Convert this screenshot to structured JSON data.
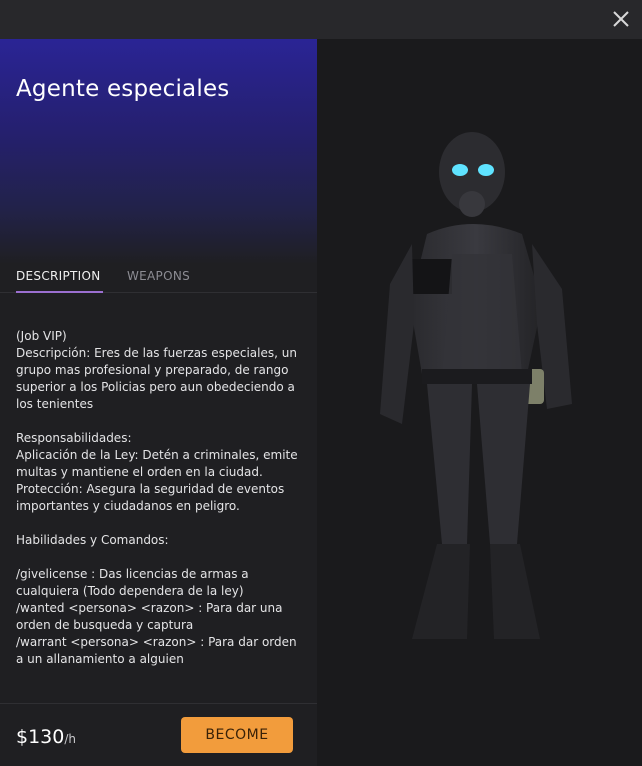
{
  "window": {
    "close_icon": "close-icon"
  },
  "job": {
    "title": "Agente especiales",
    "header_colors": {
      "top": "#2a2495",
      "bottom": "#1f1f22"
    }
  },
  "tabs": [
    {
      "label": "DESCRIPTION",
      "active": true
    },
    {
      "label": "WEAPONS",
      "active": false
    }
  ],
  "description": "(Job VIP)\nDescripción: Eres de las fuerzas especiales, un grupo mas profesional y preparado, de rango superior a los Policias pero aun obedeciendo a los tenientes\n\nResponsabilidades:\nAplicación de la Ley: Detén a criminales, emite multas y mantiene el orden en la ciudad.\nProtección: Asegura la seguridad de eventos importantes y ciudadanos en peligro.\n\nHabilidades y Comandos:\n\n/givelicense : Das licencias de armas a cualquiera (Todo dependera de la ley)\n/wanted <persona> <razon> : Para dar una orden de busqueda y captura\n/warrant <persona> <razon> : Para dar orden a un allanamiento a alguien",
  "footer": {
    "price": "$130",
    "price_unit": "/h",
    "become_label": "BECOME",
    "accent_color": "#f29c3c"
  },
  "colors": {
    "tab_underline": "#9b6fd0"
  }
}
